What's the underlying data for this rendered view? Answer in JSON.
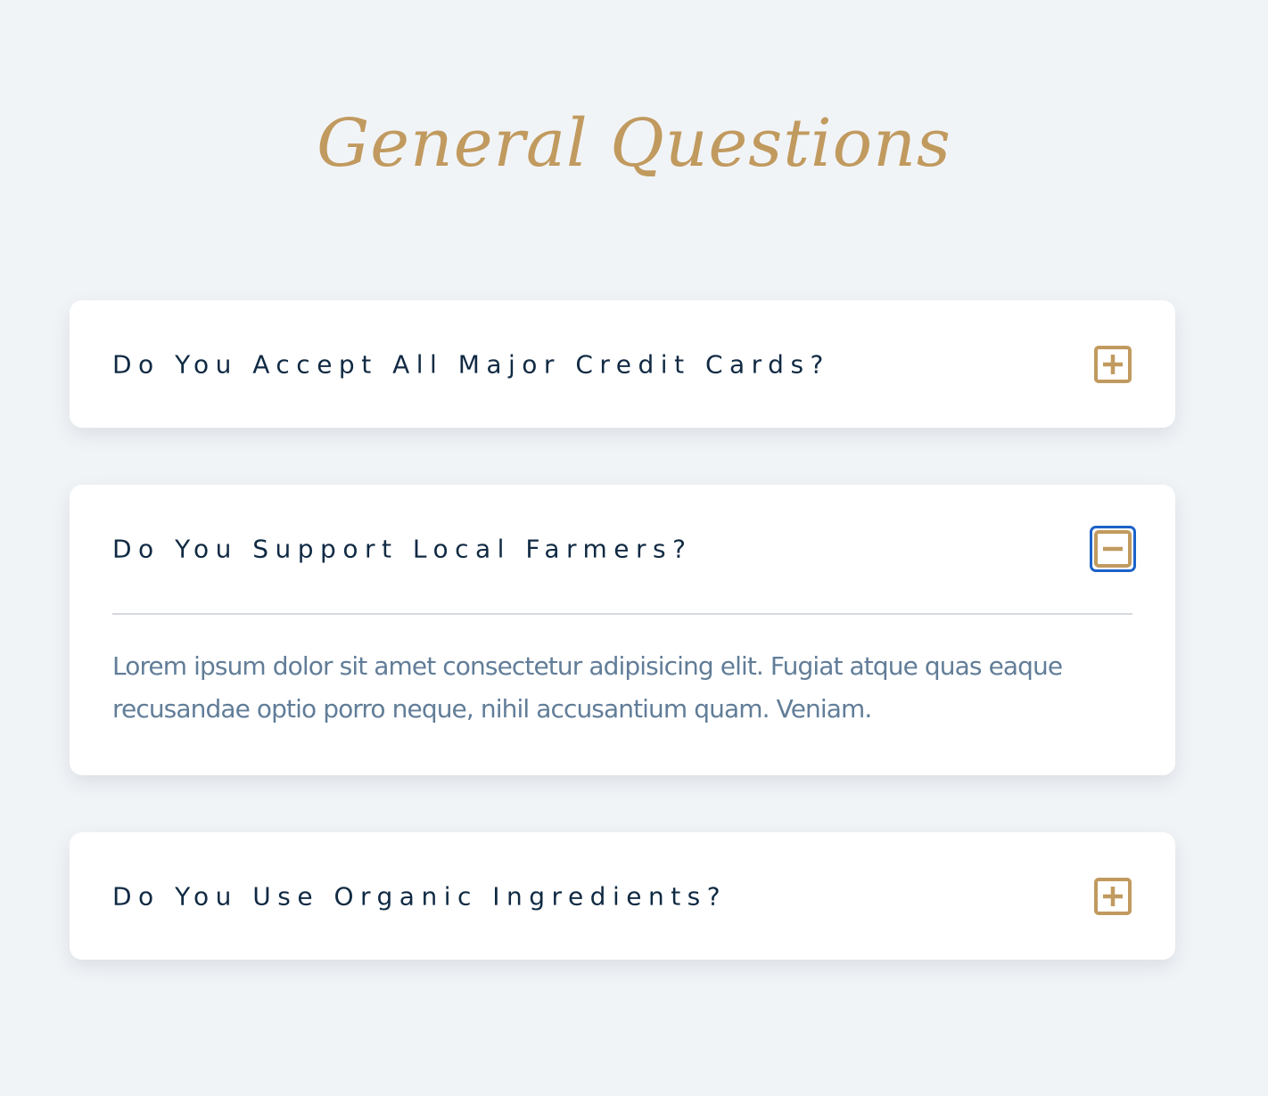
{
  "page": {
    "title": "General Questions"
  },
  "colors": {
    "background": "#f1f4f7",
    "accent_gold": "#c19a5f",
    "question_text": "#102a43",
    "answer_text": "#617d98",
    "focus_ring": "#1a62c9"
  },
  "faqs": [
    {
      "question": "Do You Accept All Major Credit Cards?",
      "expanded": false,
      "toggle_icon": "plus-square-icon"
    },
    {
      "question": "Do You Support Local Farmers?",
      "expanded": true,
      "toggle_icon": "minus-square-icon",
      "answer": "Lorem ipsum dolor sit amet consectetur adipisicing elit. Fugiat atque quas eaque recusandae optio porro neque, nihil accusantium quam. Veniam."
    },
    {
      "question": "Do You Use Organic Ingredients?",
      "expanded": false,
      "toggle_icon": "plus-square-icon"
    }
  ]
}
